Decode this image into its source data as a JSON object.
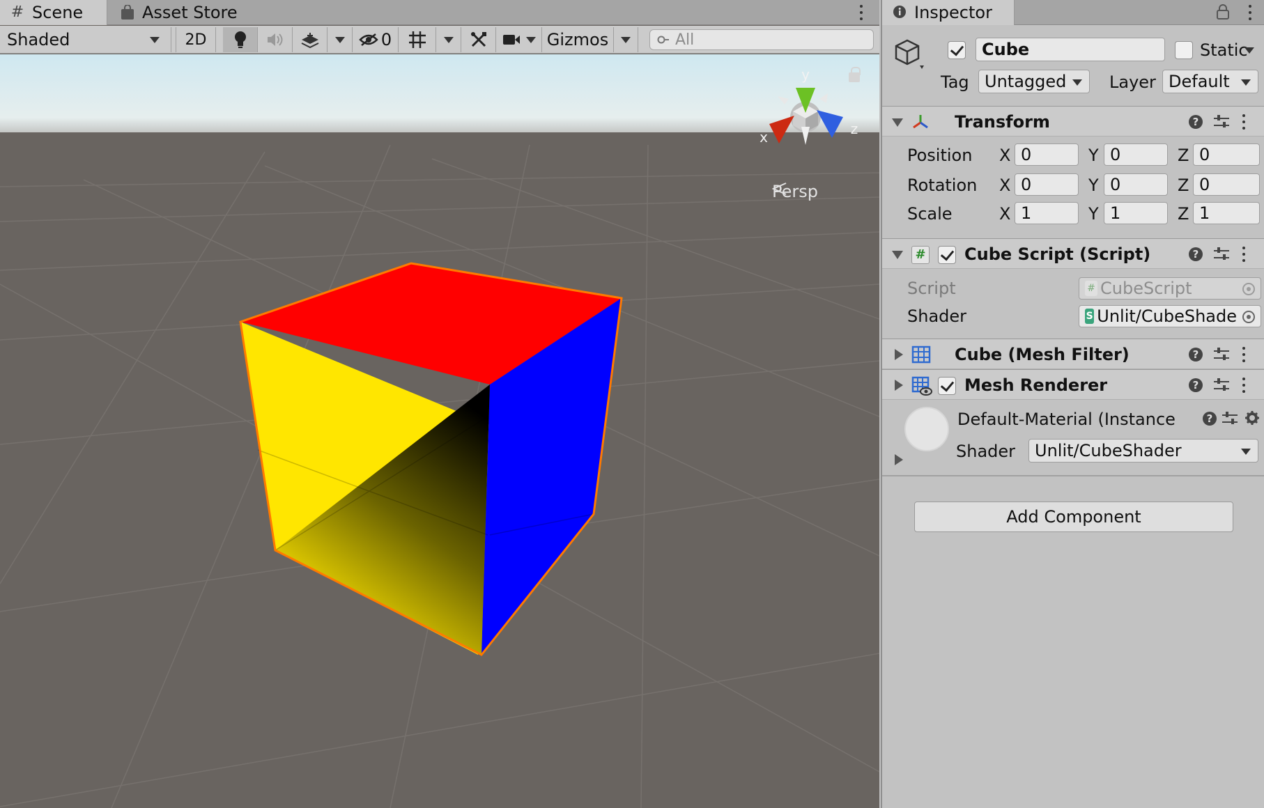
{
  "scene_tabs": {
    "scene": "Scene",
    "asset_store": "Asset Store"
  },
  "toolbar": {
    "draw_mode": "Shaded",
    "two_d": "2D",
    "hidden_count": "0",
    "gizmos": "Gizmos",
    "search_placeholder": "All",
    "icons": [
      "lightbulb-icon",
      "audio-icon",
      "effects-icon",
      "visibility-icon",
      "grid-icon",
      "tools-icon",
      "camera-icon"
    ]
  },
  "viewport": {
    "projection": "Persp",
    "axis_labels": {
      "x": "x",
      "y": "y",
      "z": "z"
    },
    "cube_face_colors": {
      "top": "#ff0000",
      "front_left": "#ffee00",
      "right": "#0000ff",
      "outline": "#ff7a00"
    },
    "sky_color": "#dfeff4",
    "ground_color": "#696460"
  },
  "inspector": {
    "tab": "Inspector",
    "object_name": "Cube",
    "active": true,
    "static_label": "Static",
    "tag_label": "Tag",
    "tag_value": "Untagged",
    "layer_label": "Layer",
    "layer_value": "Default",
    "transform": {
      "title": "Transform",
      "position_label": "Position",
      "rotation_label": "Rotation",
      "scale_label": "Scale",
      "axes": {
        "x": "X",
        "y": "Y",
        "z": "Z"
      },
      "position": {
        "x": "0",
        "y": "0",
        "z": "0"
      },
      "rotation": {
        "x": "0",
        "y": "0",
        "z": "0"
      },
      "scale": {
        "x": "1",
        "y": "1",
        "z": "1"
      }
    },
    "cube_script": {
      "title": "Cube Script (Script)",
      "script_label": "Script",
      "script_value": "CubeScript",
      "shader_label": "Shader",
      "shader_value": "Unlit/CubeShade"
    },
    "mesh_filter": {
      "title": "Cube (Mesh Filter)"
    },
    "mesh_renderer": {
      "title": "Mesh Renderer"
    },
    "material": {
      "name": "Default-Material (Instance",
      "shader_label": "Shader",
      "shader_value": "Unlit/CubeShader"
    },
    "add_component": "Add Component"
  }
}
